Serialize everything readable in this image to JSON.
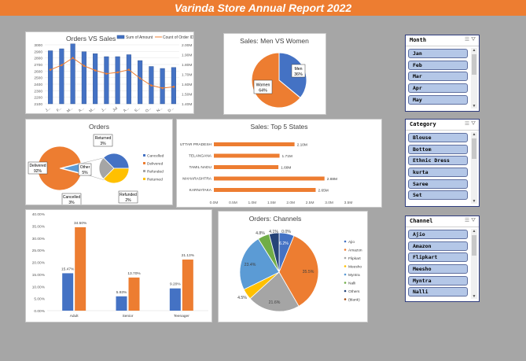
{
  "report_title": "Varinda Store Annual Report 2022",
  "colors": {
    "orange": "#ed7d31",
    "blue": "#4472c4",
    "gray": "#a5a5a5",
    "yellow": "#ffc000",
    "lightblue": "#5b9bd5",
    "green": "#70ad47",
    "navy": "#264478"
  },
  "chart_data": [
    {
      "type": "bar",
      "title": "Orders VS Sales",
      "categories": [
        "J...",
        "F...",
        "M...",
        "A...",
        "M...",
        "J...",
        "Jul",
        "A...",
        "S...",
        "O...",
        "N...",
        "D..."
      ],
      "y_ticks": [
        "2100",
        "2200",
        "2300",
        "2400",
        "2500",
        "2600",
        "2700",
        "2800",
        "2900",
        "3000"
      ],
      "y2_ticks": [
        "1.40M",
        "1.50M",
        "1.60M",
        "1.70M",
        "1.80M",
        "1.90M",
        "2.00M"
      ],
      "ylim": [
        2100,
        3000
      ],
      "y2lim": [
        1.4,
        2.0
      ],
      "series": [
        {
          "name": "Sum of Amount",
          "type": "bar",
          "values": [
            1.94,
            1.96,
            2.01,
            1.93,
            1.91,
            1.88,
            1.88,
            1.9,
            1.84,
            1.78,
            1.76,
            1.77
          ]
        },
        {
          "name": "Count of Order ID",
          "type": "line",
          "values": [
            2620,
            2690,
            2800,
            2680,
            2610,
            2560,
            2580,
            2620,
            2490,
            2380,
            2340,
            2360
          ]
        }
      ]
    },
    {
      "type": "pie",
      "title": "Sales: Men VS Women",
      "labels": [
        "Men",
        "Women"
      ],
      "values": [
        36,
        64
      ],
      "label_text": [
        "36%",
        "64%"
      ]
    },
    {
      "type": "pie",
      "title": "Orders",
      "labels": [
        "Cancelled",
        "Delivered",
        "Refunded",
        "Returned"
      ],
      "values": [
        3,
        92,
        2,
        3
      ],
      "label_text": [
        "3%",
        "92%",
        "2%",
        "3%"
      ],
      "other_label": "Other",
      "other_value": "5%",
      "legend": [
        "Cancelled",
        "Delivered",
        "Refunded",
        "Returned"
      ]
    },
    {
      "type": "bar",
      "title": "Sales: Top 5 States",
      "categories": [
        "UTTAR PRADESH",
        "TELANGANA",
        "TAMIL NADU",
        "MAHARASHTRA",
        "KARNATAKA"
      ],
      "values": [
        2.1,
        1.71,
        1.68,
        2.88,
        2.65
      ],
      "value_labels": [
        "2.10M",
        "1.71M",
        "1.68M",
        "2.88M",
        "2.65M"
      ],
      "x_ticks": [
        "0.0M",
        "0.5M",
        "1.0M",
        "1.5M",
        "2.0M",
        "2.5M",
        "3.0M",
        "3.5M"
      ],
      "xlim": [
        0,
        3.5
      ]
    },
    {
      "type": "bar",
      "categories": [
        "Adult",
        "Senior",
        "Teenager"
      ],
      "series": [
        {
          "values": [
            15.47,
            5.93,
            9.2
          ],
          "labels": [
            "15.47%",
            "5.93%",
            "9.20%"
          ]
        },
        {
          "values": [
            34.5,
            13.7,
            21.13
          ],
          "labels": [
            "34.50%",
            "13.70%",
            "21.13%"
          ]
        }
      ],
      "y_ticks": [
        "0.00%",
        "5.00%",
        "10.00%",
        "15.00%",
        "20.00%",
        "25.00%",
        "30.00%",
        "35.00%",
        "40.00%"
      ],
      "ylim": [
        0,
        40
      ]
    },
    {
      "type": "pie",
      "title": "Orders: Channels",
      "labels": [
        "Ajio",
        "Amazon",
        "Flipkart",
        "Meesho",
        "Myntra",
        "Nalli",
        "Others",
        "(blank)"
      ],
      "values": [
        6.2,
        35.5,
        21.6,
        4.5,
        23.4,
        4.8,
        4.1,
        0.0
      ],
      "label_text": [
        "6.2%",
        "35.5%",
        "21.6%",
        "4.5%",
        "23.4%",
        "4.8%",
        "4.1%",
        "0.0%"
      ]
    }
  ],
  "slicers": [
    {
      "title": "Month",
      "items": [
        "Jan",
        "Feb",
        "Mar",
        "Apr",
        "May"
      ]
    },
    {
      "title": "Category",
      "items": [
        "Blouse",
        "Bottom",
        "Ethnic Dress",
        "kurta",
        "Saree",
        "Set"
      ]
    },
    {
      "title": "Channel",
      "items": [
        "Ajio",
        "Amazon",
        "Flipkart",
        "Meesho",
        "Myntra",
        "Nalli"
      ]
    }
  ],
  "slicer_icons": [
    "multi-select-icon",
    "clear-filter-icon"
  ]
}
